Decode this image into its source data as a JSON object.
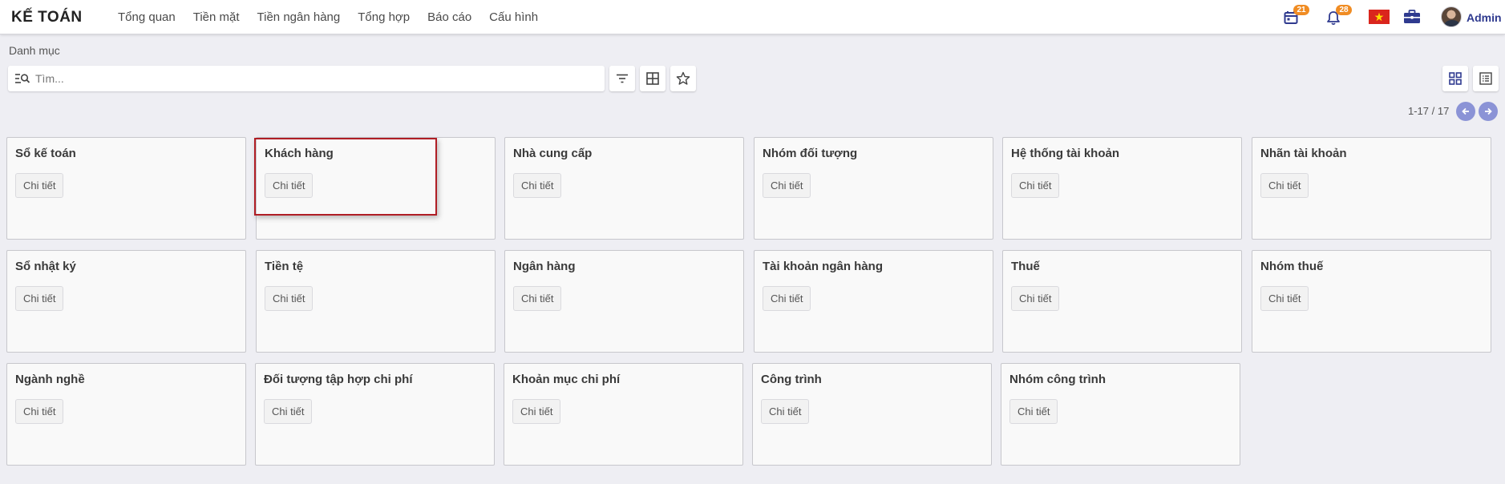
{
  "app": {
    "title": "KẾ TOÁN"
  },
  "menu": [
    "Tổng quan",
    "Tiền mặt",
    "Tiền ngân hàng",
    "Tổng hợp",
    "Báo cáo",
    "Cấu hình"
  ],
  "header": {
    "calendar_badge": "21",
    "bell_badge": "28",
    "user_name": "Admin"
  },
  "breadcrumb": "Danh mục",
  "search": {
    "placeholder": "Tìm...",
    "value": ""
  },
  "pager": {
    "text": "1-17 / 17"
  },
  "colors": {
    "accent": "#2f3a8f",
    "badge": "#f08c23",
    "highlight": "#b01e25",
    "pager_button": "#8b93d6"
  },
  "cards": [
    {
      "title": "Sổ kế toán",
      "button": "Chi tiết"
    },
    {
      "title": "Khách hàng",
      "button": "Chi tiết"
    },
    {
      "title": "Nhà cung cấp",
      "button": "Chi tiết"
    },
    {
      "title": "Nhóm đối tượng",
      "button": "Chi tiết"
    },
    {
      "title": "Hệ thống tài khoản",
      "button": "Chi tiết"
    },
    {
      "title": "Nhãn tài khoản",
      "button": "Chi tiết"
    },
    {
      "title": "Sổ nhật ký",
      "button": "Chi tiết"
    },
    {
      "title": "Tiền tệ",
      "button": "Chi tiết"
    },
    {
      "title": "Ngân hàng",
      "button": "Chi tiết"
    },
    {
      "title": "Tài khoản ngân hàng",
      "button": "Chi tiết"
    },
    {
      "title": "Thuế",
      "button": "Chi tiết"
    },
    {
      "title": "Nhóm thuế",
      "button": "Chi tiết"
    },
    {
      "title": "Ngành nghề",
      "button": "Chi tiết"
    },
    {
      "title": "Đối tượng tập hợp chi phí",
      "button": "Chi tiết"
    },
    {
      "title": "Khoản mục chi phí",
      "button": "Chi tiết"
    },
    {
      "title": "Công trình",
      "button": "Chi tiết"
    },
    {
      "title": "Nhóm công trình",
      "button": "Chi tiết"
    }
  ]
}
